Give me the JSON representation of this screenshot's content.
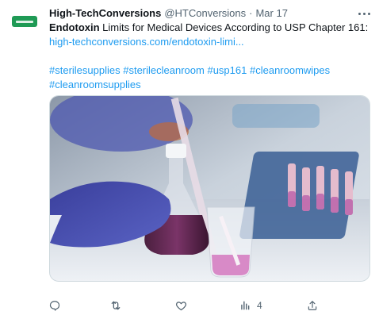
{
  "tweet": {
    "display_name": "High-TechConversions",
    "handle": "@HTConversions",
    "separator": "·",
    "date": "Mar 17",
    "text_bold": "Endotoxin",
    "text_rest": " Limits for Medical Devices According to USP Chapter 161:",
    "link": "high-techconversions.com/endotoxin-limi...",
    "hashtags": [
      "#sterilesupplies",
      "#sterilecleanroom",
      "#usp161",
      "#cleanroomwipes",
      "#cleanroomsupplies"
    ],
    "views_count": "4"
  },
  "icons": {
    "reply": "reply-icon",
    "retweet": "retweet-icon",
    "like": "heart-icon",
    "views": "analytics-icon",
    "share": "share-icon",
    "more": "more-icon"
  },
  "colors": {
    "link": "#1d9bf0",
    "secondary_text": "#536471",
    "glove": "#4a4fb0",
    "liquid": "#c04aa8"
  }
}
